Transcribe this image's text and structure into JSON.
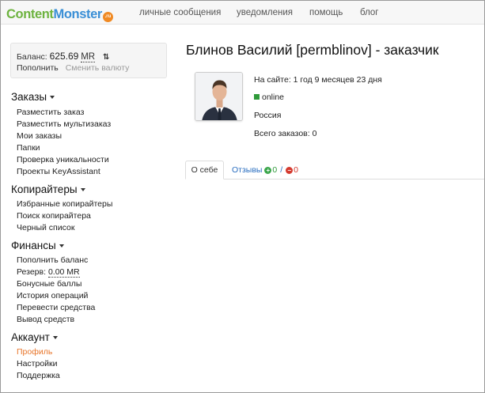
{
  "brand": {
    "part1": "Content",
    "part2": "Monster",
    "badge": ".ru"
  },
  "nav": {
    "messages": "личные сообщения",
    "notifications": "уведомления",
    "help": "помощь",
    "blog": "блог"
  },
  "balance": {
    "label": "Баланс:",
    "amount": "625.69",
    "currency": "MR",
    "topup": "Пополнить",
    "change_currency": "Сменить валюту"
  },
  "sidebar": {
    "orders": {
      "title": "Заказы",
      "items": [
        "Разместить заказ",
        "Разместить мультизаказ",
        "Мои заказы",
        "Папки",
        "Проверка уникальности",
        "Проекты KeyAssistant"
      ]
    },
    "copywriters": {
      "title": "Копирайтеры",
      "items": [
        "Избранные копирайтеры",
        "Поиск копирайтера",
        "Черный список"
      ]
    },
    "finance": {
      "title": "Финансы",
      "topup": "Пополнить баланс",
      "reserve_label": "Резерв:",
      "reserve_value": "0.00 MR",
      "items_after": [
        "Бонусные баллы",
        "История операций",
        "Перевести средства",
        "Вывод средств"
      ]
    },
    "account": {
      "title": "Аккаунт",
      "items": [
        "Профиль",
        "Настройки",
        "Поддержка"
      ]
    }
  },
  "profile": {
    "title": "Блинов Василий [permblinov] - заказчик",
    "on_site": "На сайте: 1 год 9 месяцев 23 дня",
    "status": "online",
    "country": "Россия",
    "total_orders": "Всего заказов: 0"
  },
  "tabs": {
    "about": "О себе",
    "reviews": "Отзывы",
    "positive": "0",
    "separator": "/",
    "negative": "0"
  },
  "colors": {
    "accent_active": "#e8762b",
    "link": "#2a6ec0",
    "online": "#2f9a3a",
    "logo_green": "#6db33f",
    "logo_blue": "#3a8fd6"
  }
}
